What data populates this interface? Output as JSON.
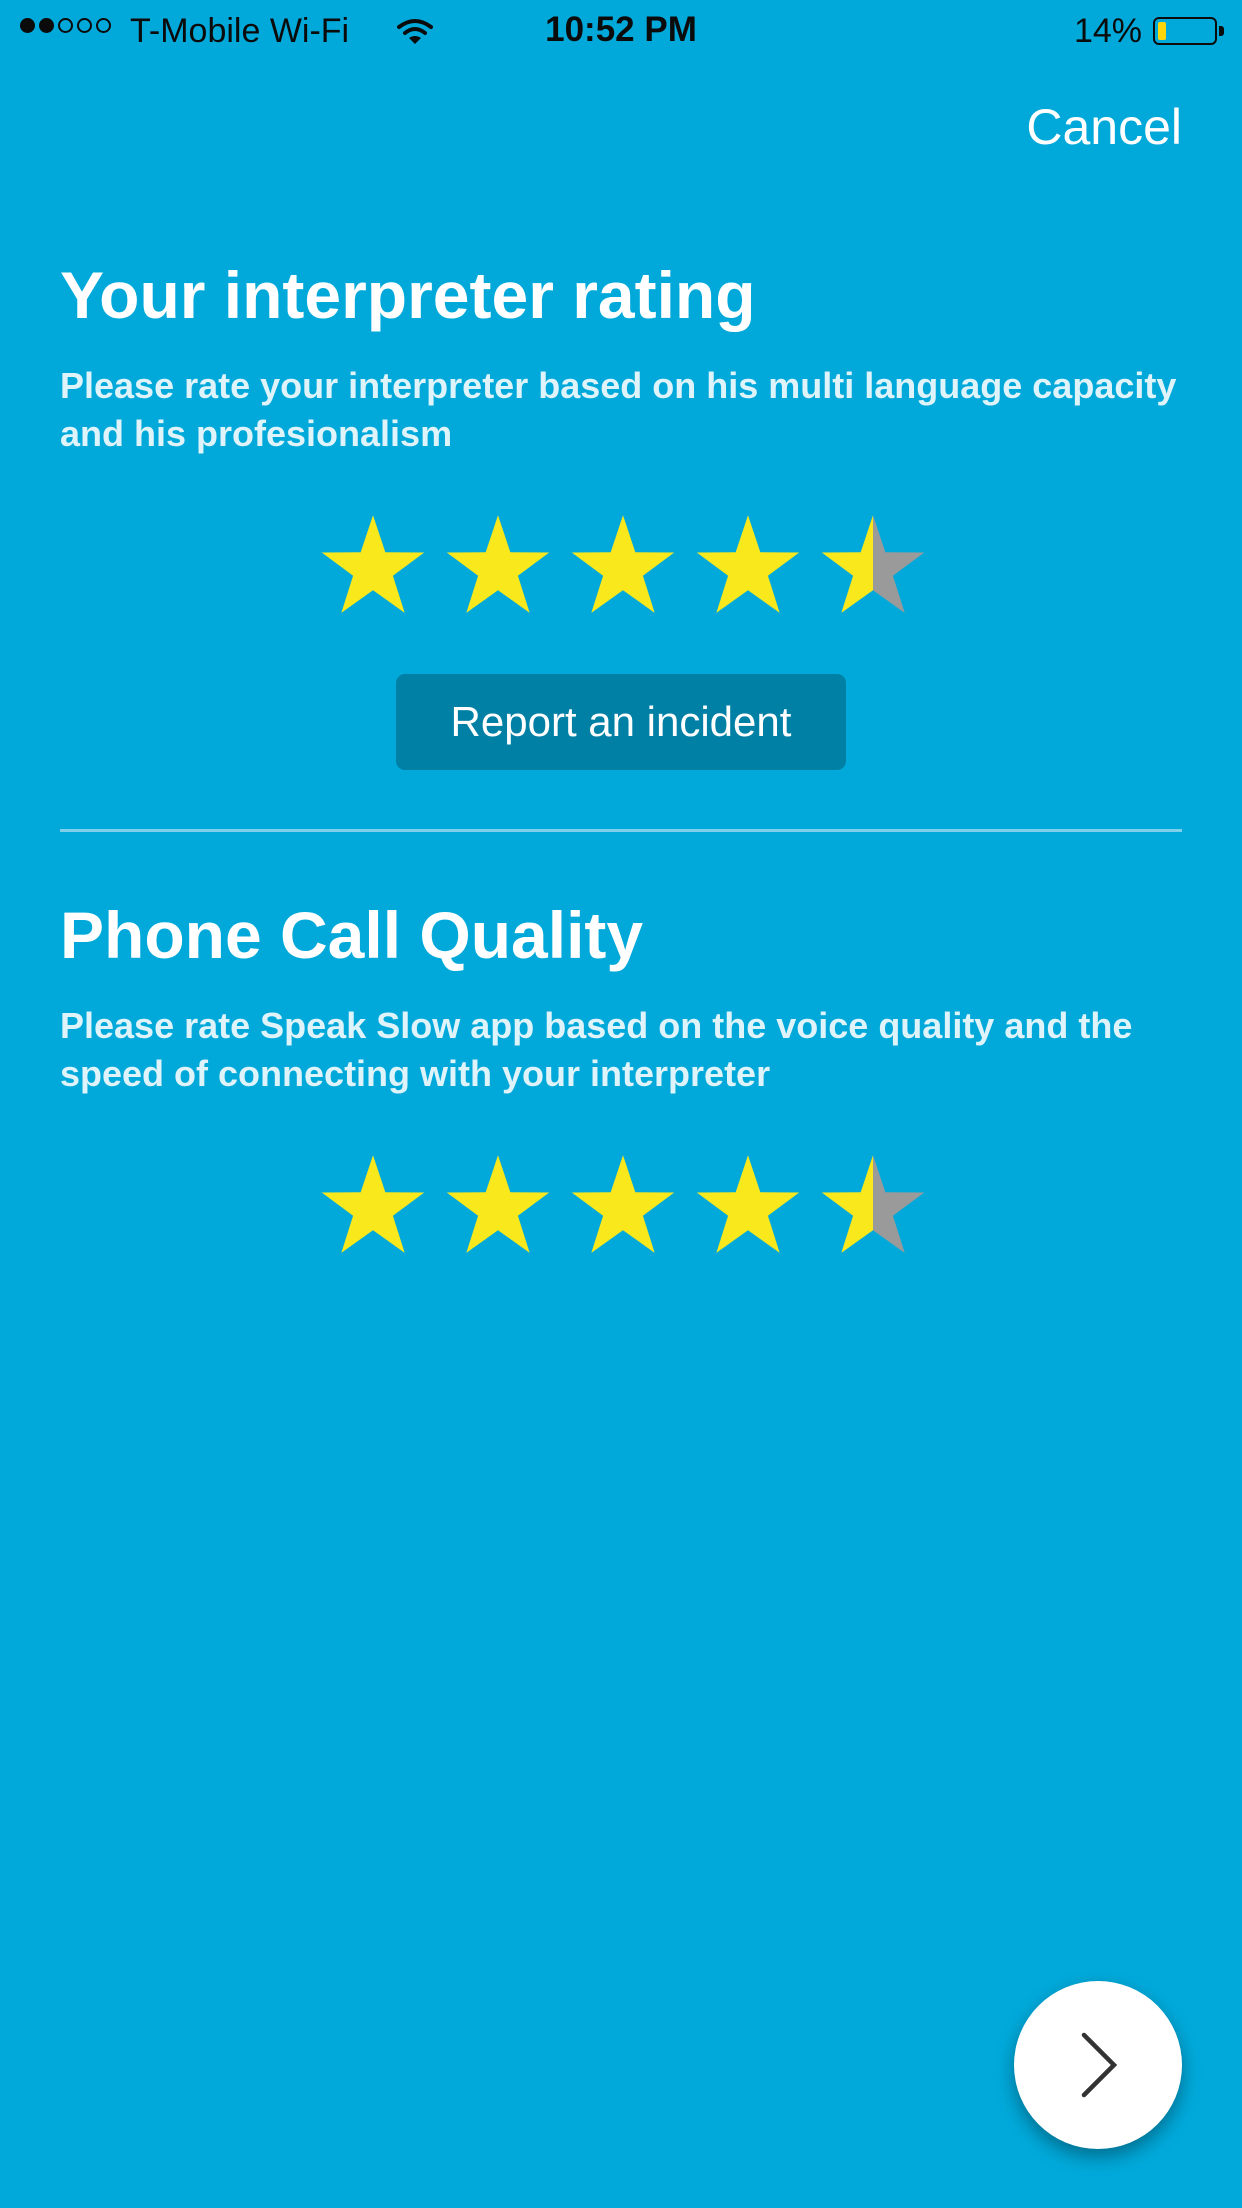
{
  "status_bar": {
    "carrier": "T-Mobile Wi-Fi",
    "signal_bars_filled": 2,
    "signal_bars_total": 5,
    "time": "10:52 PM",
    "battery_percent": "14%",
    "battery_level": 0.14,
    "icons": [
      "signal-icon",
      "wifi-icon",
      "battery-icon"
    ]
  },
  "header": {
    "cancel_label": "Cancel"
  },
  "interpreter_rating": {
    "title": "Your interpreter rating",
    "description": "Please rate your interpreter based on his multi language capacity and his profesionalism",
    "rating": 4.5,
    "max_rating": 5,
    "report_label": "Report an incident"
  },
  "call_quality": {
    "title": "Phone Call Quality",
    "description": "Please rate Speak Slow app based on the voice quality and the speed of connecting with your interpreter",
    "rating": 4.5,
    "max_rating": 5
  },
  "next_button": {
    "icon": "chevron-right-icon"
  },
  "colors": {
    "background": "#00a9da",
    "star_filled": "#f9e81c",
    "star_empty": "#9a9a9a",
    "button_background": "#0180a6",
    "divider": "#7fd0ea"
  }
}
